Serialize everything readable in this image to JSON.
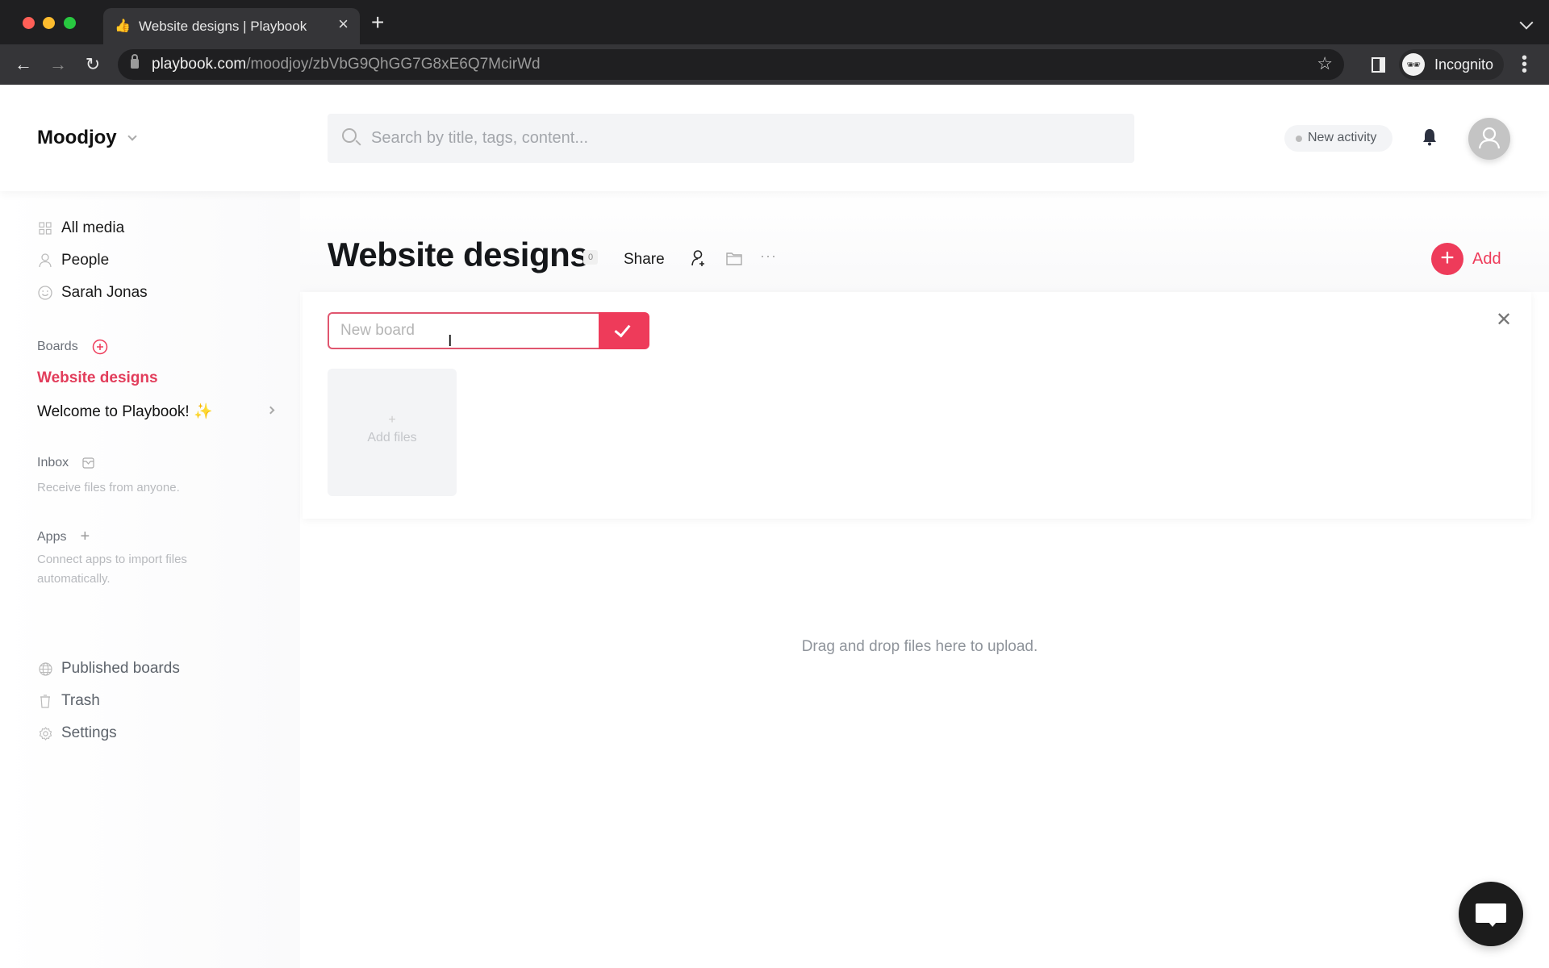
{
  "browser": {
    "tab_title": "Website designs | Playbook",
    "url_domain": "playbook.com",
    "url_path": "/moodjoy/zbVbG9QhGG7G8xE6Q7McirWd",
    "profile_label": "Incognito",
    "traffic_colors": {
      "close": "#ff5f57",
      "minimize": "#febc2e",
      "zoom": "#28c840"
    }
  },
  "header": {
    "workspace_name": "Moodjoy",
    "search_placeholder": "Search by title, tags, content...",
    "new_activity_label": "New activity"
  },
  "sidebar": {
    "nav": [
      {
        "label": "All media",
        "icon": "grid-icon"
      },
      {
        "label": "People",
        "icon": "person-icon"
      },
      {
        "label": "Sarah Jonas",
        "icon": "smiley-icon"
      }
    ],
    "boards_label": "Boards",
    "boards": [
      {
        "label": "Website designs",
        "active": true
      },
      {
        "label": "Welcome to Playbook! ✨",
        "active": false
      }
    ],
    "inbox_label": "Inbox",
    "inbox_desc": "Receive files from anyone.",
    "apps_label": "Apps",
    "apps_desc": "Connect apps to import files automatically.",
    "footer_nav": [
      {
        "label": "Published boards",
        "icon": "globe-icon"
      },
      {
        "label": "Trash",
        "icon": "trash-icon"
      },
      {
        "label": "Settings",
        "icon": "gear-icon"
      }
    ]
  },
  "main": {
    "board_title": "Website designs",
    "item_count": "0",
    "share_label": "Share",
    "more_label": "···",
    "add_label": "Add",
    "new_board_placeholder": "New board",
    "new_board_value": "",
    "add_files_plus": "+",
    "add_files_label": "Add files",
    "drop_hint": "Drag and drop files here to upload."
  },
  "colors": {
    "accent": "#ee3b5a",
    "input_border": "#e0566f",
    "text_primary": "#15171a",
    "muted": "#8f949b"
  }
}
